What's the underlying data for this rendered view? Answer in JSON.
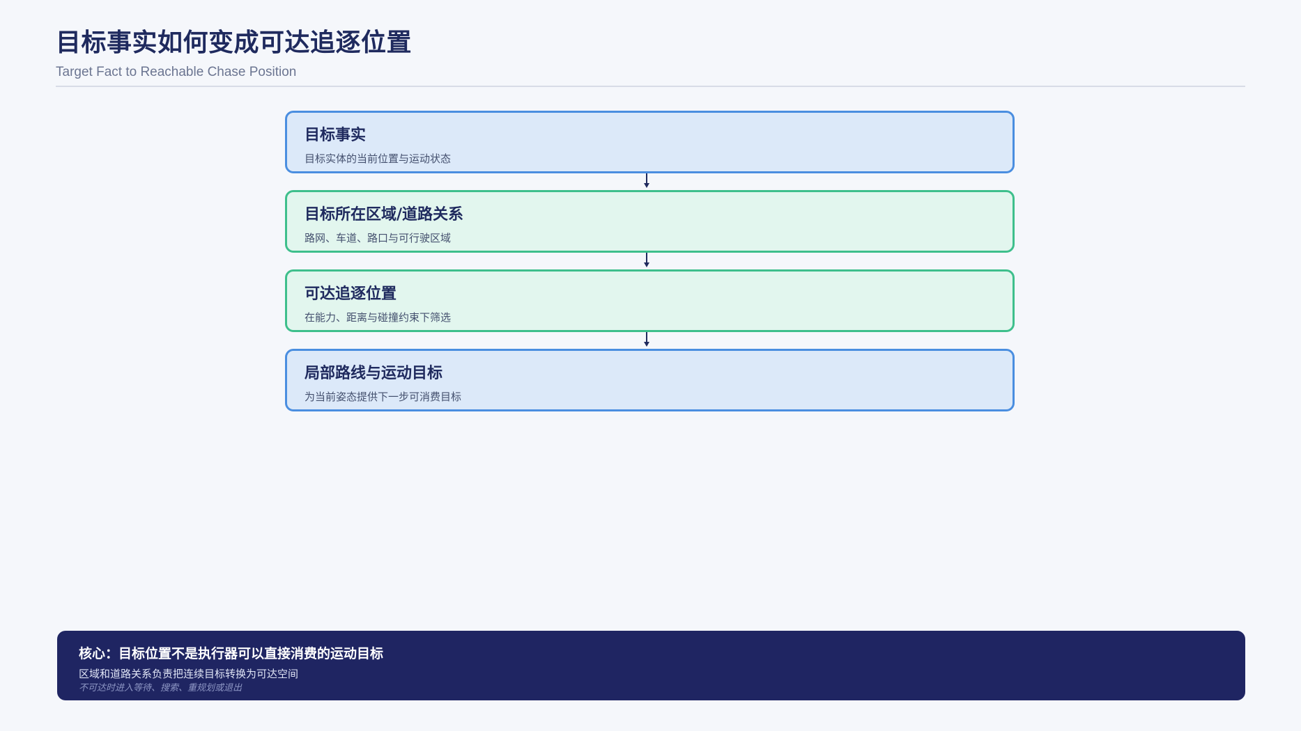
{
  "header": {
    "title": "目标事实如何变成可达追逐位置",
    "subtitle": "Target Fact to Reachable Chase Position"
  },
  "flow": {
    "steps": [
      {
        "title": "目标事实",
        "desc": "目标实体的当前位置与运动状态",
        "color": "#4a8ee0"
      },
      {
        "title": "目标所在区域/道路关系",
        "desc": "路网、车道、路口与可行驶区域",
        "color": "#3ebf8c"
      },
      {
        "title": "可达追逐位置",
        "desc": "在能力、距离与碰撞约束下筛选",
        "color": "#3ebf8c"
      },
      {
        "title": "局部路线与运动目标",
        "desc": "为当前姿态提供下一步可消费目标",
        "color": "#4a8ee0"
      }
    ]
  },
  "core": {
    "title": "核心：目标位置不是执行器可以直接消费的运动目标",
    "desc": "区域和道路关系负责把连续目标转换为可达空间",
    "note": "不可达时进入等待、搜索、重规划或退出"
  }
}
